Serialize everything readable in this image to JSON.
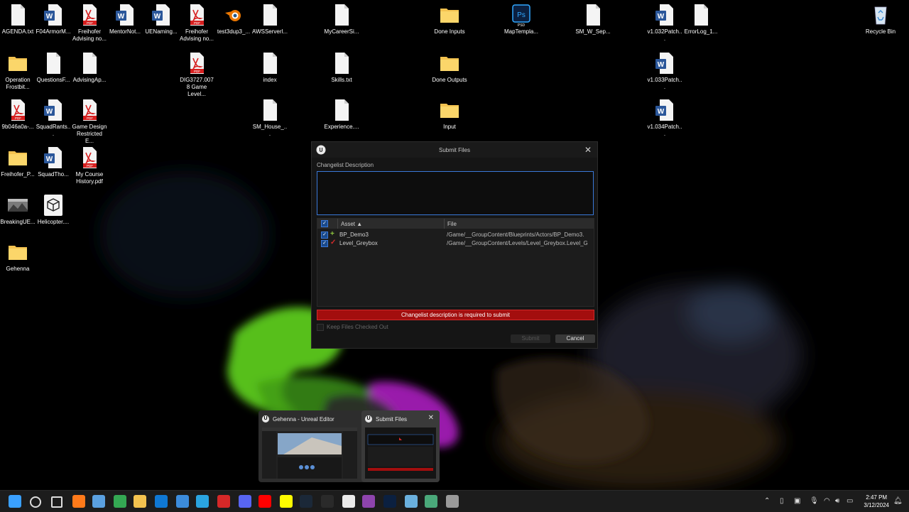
{
  "desktop": {
    "icons": [
      {
        "label": "AGENDA.txt",
        "kind": "txt"
      },
      {
        "label": "F04ArmorM...",
        "kind": "word"
      },
      {
        "label": "Freihofer Advising no...",
        "kind": "pdf"
      },
      {
        "label": "MentorNot...",
        "kind": "word"
      },
      {
        "label": "UENaming...",
        "kind": "word"
      },
      {
        "label": "Freihofer Advising no...",
        "kind": "pdf"
      },
      {
        "label": "test3dup3_...",
        "kind": "blender"
      },
      {
        "label": "AWSServerl...",
        "kind": "txt"
      },
      {
        "label": "MyCareerSi...",
        "kind": "txt"
      },
      {
        "label": "Done Inputs",
        "kind": "folder"
      },
      {
        "label": "MapTempla...",
        "kind": "psd"
      },
      {
        "label": "SM_W_Sep...",
        "kind": "txt"
      },
      {
        "label": "v1.032Patch...",
        "kind": "word"
      },
      {
        "label": "ErrorLog_1...",
        "kind": "txt"
      },
      {
        "label": "Recycle Bin",
        "kind": "recycle"
      },
      {
        "label": "Operation Frostbit...",
        "kind": "folder"
      },
      {
        "label": "QuestionsF...",
        "kind": "txt"
      },
      {
        "label": "AdvisingAp...",
        "kind": "txt"
      },
      {
        "label": "DIG3727.0078 Game Level...",
        "kind": "pdf"
      },
      {
        "label": "index",
        "kind": "txt"
      },
      {
        "label": "Skills.txt",
        "kind": "txt"
      },
      {
        "label": "Done Outputs",
        "kind": "folder"
      },
      {
        "label": "v1.033Patch...",
        "kind": "word"
      },
      {
        "label": "9b046a0a-...",
        "kind": "pdf"
      },
      {
        "label": "SquadRants...",
        "kind": "word"
      },
      {
        "label": "Game Design Restricted E...",
        "kind": "pdf"
      },
      {
        "label": "SM_House_...",
        "kind": "txt"
      },
      {
        "label": "Experience....",
        "kind": "txt"
      },
      {
        "label": "Input",
        "kind": "folder"
      },
      {
        "label": "v1.034Patch...",
        "kind": "word"
      },
      {
        "label": "Freihofer_P...",
        "kind": "folder"
      },
      {
        "label": "SquadTho...",
        "kind": "word"
      },
      {
        "label": "My Course History.pdf",
        "kind": "pdf"
      },
      {
        "label": "BreakingUE...",
        "kind": "image"
      },
      {
        "label": "Helicopter....",
        "kind": "model"
      },
      {
        "label": "Gehenna",
        "kind": "folder"
      }
    ]
  },
  "dialog": {
    "title": "Submit Files",
    "close": "✕",
    "desc_label": "Changelist Description",
    "desc_value": "",
    "columns": {
      "asset": "Asset ▲",
      "file": "File"
    },
    "rows": [
      {
        "asset": "BP_Demo3",
        "file": "/Game/__GroupContent/Blueprints/Actors/BP_Demo3.",
        "status": "add",
        "status_color": "#8fc63f"
      },
      {
        "asset": "Level_Greybox",
        "file": "/Game/__GroupContent/Levels/Level_Greybox.Level_G",
        "status": "edit",
        "status_color": "#d12a2a"
      }
    ],
    "error": "Changelist description is required to submit",
    "keep_checked_out": "Keep Files Checked Out",
    "submit": "Submit",
    "cancel": "Cancel"
  },
  "switcher": {
    "windows": [
      {
        "title": "Gehenna - Unreal Editor"
      },
      {
        "title": "Submit Files",
        "close": "✕"
      }
    ]
  },
  "taskbar": {
    "time": "2:47 PM",
    "date": "3/12/2024",
    "apps": [
      "start-icon",
      "search-icon",
      "task-view-icon",
      "firefox-icon",
      "photos-icon",
      "chrome-icon",
      "file-explorer-icon",
      "outlook-icon",
      "mail-icon",
      "edge-icon",
      "game-icon",
      "discord-icon",
      "youtube-icon",
      "snapchat-icon",
      "steam-icon",
      "epic-icon",
      "unreal-icon",
      "github-icon",
      "photoshop-icon",
      "notepad-icon",
      "teams-icon",
      "settings-icon"
    ]
  }
}
